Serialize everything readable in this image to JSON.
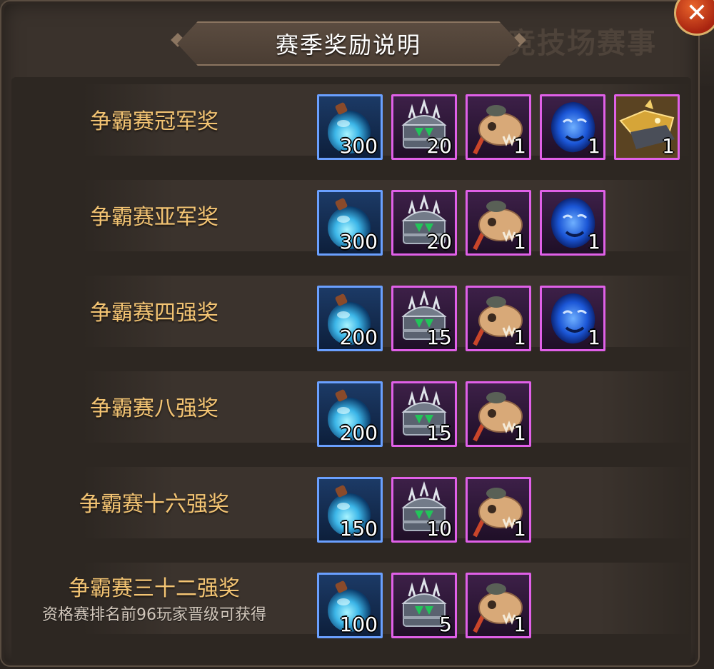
{
  "dialog": {
    "title": "赛季奖励说明",
    "background_title": "第三季公开竞技场赛事",
    "close_symbol": "✕"
  },
  "colors": {
    "label_gold": "#f3c473",
    "border_blue": "#6aa0ff",
    "border_purple": "#e060e8"
  },
  "rewards": [
    {
      "name": "争霸赛冠军奖",
      "items": [
        {
          "icon": "blue-potion-icon",
          "rarity": "blue",
          "count": "300"
        },
        {
          "icon": "spiked-chest-icon",
          "rarity": "purple",
          "count": "20"
        },
        {
          "icon": "skull-horn-icon",
          "rarity": "purple",
          "count": "1"
        },
        {
          "icon": "blue-lion-icon",
          "rarity": "purple",
          "count": "1"
        },
        {
          "icon": "golden-beast-mount-icon",
          "rarity": "purple",
          "count": "1"
        }
      ]
    },
    {
      "name": "争霸赛亚军奖",
      "items": [
        {
          "icon": "blue-potion-icon",
          "rarity": "blue",
          "count": "300"
        },
        {
          "icon": "spiked-chest-icon",
          "rarity": "purple",
          "count": "20"
        },
        {
          "icon": "skull-horn-icon",
          "rarity": "purple",
          "count": "1"
        },
        {
          "icon": "blue-lion-icon",
          "rarity": "purple",
          "count": "1"
        }
      ]
    },
    {
      "name": "争霸赛四强奖",
      "items": [
        {
          "icon": "blue-potion-icon",
          "rarity": "blue",
          "count": "200"
        },
        {
          "icon": "spiked-chest-icon",
          "rarity": "purple",
          "count": "15"
        },
        {
          "icon": "skull-horn-icon",
          "rarity": "purple",
          "count": "1"
        },
        {
          "icon": "blue-lion-icon",
          "rarity": "purple",
          "count": "1"
        }
      ]
    },
    {
      "name": "争霸赛八强奖",
      "items": [
        {
          "icon": "blue-potion-icon",
          "rarity": "blue",
          "count": "200"
        },
        {
          "icon": "spiked-chest-icon",
          "rarity": "purple",
          "count": "15"
        },
        {
          "icon": "skull-horn-icon",
          "rarity": "purple",
          "count": "1"
        }
      ]
    },
    {
      "name": "争霸赛十六强奖",
      "items": [
        {
          "icon": "blue-potion-icon",
          "rarity": "blue",
          "count": "150"
        },
        {
          "icon": "spiked-chest-icon",
          "rarity": "purple",
          "count": "10"
        },
        {
          "icon": "skull-horn-icon",
          "rarity": "purple",
          "count": "1"
        }
      ]
    },
    {
      "name": "争霸赛三十二强奖",
      "subtitle": "资格赛排名前96玩家晋级可获得",
      "items": [
        {
          "icon": "blue-potion-icon",
          "rarity": "blue",
          "count": "100"
        },
        {
          "icon": "spiked-chest-icon",
          "rarity": "purple",
          "count": "5"
        },
        {
          "icon": "skull-horn-icon",
          "rarity": "purple",
          "count": "1"
        }
      ]
    }
  ]
}
